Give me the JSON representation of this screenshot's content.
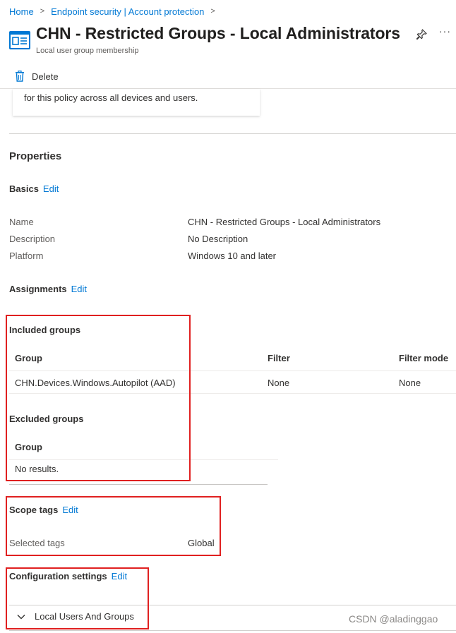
{
  "breadcrumb": {
    "items": [
      "Home",
      "Endpoint security | Account protection"
    ],
    "separator": ">"
  },
  "header": {
    "title": "CHN - Restricted Groups - Local Administrators",
    "subtitle": "Local user group membership",
    "icon": "policy-blade-icon",
    "pin_icon": "pin-icon",
    "more_label": "···"
  },
  "toolbar": {
    "delete_label": "Delete",
    "delete_icon": "trash-icon"
  },
  "info_card": {
    "text": "for this policy across all devices and users."
  },
  "properties": {
    "heading": "Properties",
    "basics": {
      "heading": "Basics",
      "edit_label": "Edit",
      "rows": [
        {
          "label": "Name",
          "value": "CHN - Restricted Groups - Local Administrators"
        },
        {
          "label": "Description",
          "value": "No Description"
        },
        {
          "label": "Platform",
          "value": "Windows 10 and later"
        }
      ]
    },
    "assignments": {
      "heading": "Assignments",
      "edit_label": "Edit",
      "included": {
        "heading": "Included groups",
        "columns": [
          "Group",
          "Filter",
          "Filter mode"
        ],
        "rows": [
          [
            "CHN.Devices.Windows.Autopilot (AAD)",
            "None",
            "None"
          ]
        ]
      },
      "excluded": {
        "heading": "Excluded groups",
        "columns": [
          "Group"
        ],
        "empty_text": "No results."
      }
    },
    "scope_tags": {
      "heading": "Scope tags",
      "edit_label": "Edit",
      "label": "Selected tags",
      "value": "Global"
    },
    "configuration": {
      "heading": "Configuration settings",
      "edit_label": "Edit",
      "accordion_label": "Local Users And Groups"
    }
  },
  "watermark": "CSDN @aladinggao",
  "colors": {
    "link": "#0078d4",
    "highlight": "#e02020",
    "text": "#323130",
    "muted": "#605e5c"
  }
}
